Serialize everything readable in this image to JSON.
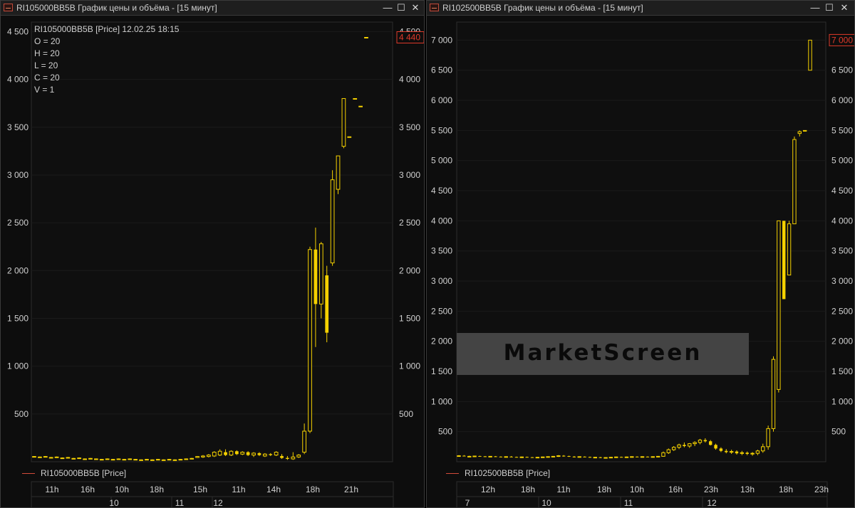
{
  "windows": [
    {
      "title": "RI105000BB5B График цены и объёма - [15 минут]",
      "info": {
        "header": "RI105000BB5B [Price] 12.02.25 18:15",
        "o": "O = 20",
        "h": "H = 20",
        "l": "L = 20",
        "c": "C = 20",
        "v": "V = 1"
      },
      "legend": "RI105000BB5B [Price]",
      "controls": {
        "minimize": "—",
        "maximize": "☐",
        "close": "✕"
      }
    },
    {
      "title": "RI102500BB5B График цены и объёма - [15 минут]",
      "legend": "RI102500BB5B [Price]",
      "controls": {
        "minimize": "—",
        "maximize": "☐",
        "close": "✕"
      }
    }
  ],
  "watermark": "MarketScreen",
  "colors": {
    "candle": "#f5d100",
    "last_price": "#e03a2a",
    "grid": "#1e1e1e",
    "axis_text": "#d0d0d0"
  },
  "chart_data": [
    {
      "type": "candlestick",
      "series_name": "RI105000BB5B [Price]",
      "ylim": [
        0,
        4600
      ],
      "y_ticks": [
        500,
        1000,
        1500,
        2000,
        2500,
        3000,
        3500,
        4000,
        4500
      ],
      "last_price": 4440,
      "last_price_label": "4 440",
      "x_time_labels": [
        "11h",
        "16h",
        "10h",
        "18h",
        "15h",
        "11h",
        "14h",
        "18h",
        "21h"
      ],
      "x_date_labels": [
        "10",
        "11",
        "12"
      ],
      "candles": [
        {
          "o": 55,
          "h": 60,
          "l": 50,
          "c": 55
        },
        {
          "o": 50,
          "h": 55,
          "l": 45,
          "c": 50
        },
        {
          "o": 55,
          "h": 60,
          "l": 50,
          "c": 55
        },
        {
          "o": 45,
          "h": 50,
          "l": 40,
          "c": 45
        },
        {
          "o": 50,
          "h": 55,
          "l": 45,
          "c": 50
        },
        {
          "o": 40,
          "h": 45,
          "l": 35,
          "c": 40
        },
        {
          "o": 45,
          "h": 50,
          "l": 40,
          "c": 45
        },
        {
          "o": 35,
          "h": 40,
          "l": 30,
          "c": 35
        },
        {
          "o": 40,
          "h": 45,
          "l": 35,
          "c": 40
        },
        {
          "o": 30,
          "h": 35,
          "l": 25,
          "c": 30
        },
        {
          "o": 35,
          "h": 40,
          "l": 30,
          "c": 35
        },
        {
          "o": 30,
          "h": 35,
          "l": 25,
          "c": 30
        },
        {
          "o": 25,
          "h": 30,
          "l": 20,
          "c": 25
        },
        {
          "o": 30,
          "h": 35,
          "l": 25,
          "c": 30
        },
        {
          "o": 25,
          "h": 30,
          "l": 20,
          "c": 25
        },
        {
          "o": 30,
          "h": 35,
          "l": 25,
          "c": 30
        },
        {
          "o": 25,
          "h": 30,
          "l": 20,
          "c": 25
        },
        {
          "o": 30,
          "h": 35,
          "l": 25,
          "c": 30
        },
        {
          "o": 25,
          "h": 30,
          "l": 20,
          "c": 25
        },
        {
          "o": 20,
          "h": 25,
          "l": 15,
          "c": 20
        },
        {
          "o": 25,
          "h": 30,
          "l": 20,
          "c": 25
        },
        {
          "o": 20,
          "h": 25,
          "l": 15,
          "c": 20
        },
        {
          "o": 25,
          "h": 30,
          "l": 20,
          "c": 25
        },
        {
          "o": 20,
          "h": 25,
          "l": 15,
          "c": 20
        },
        {
          "o": 25,
          "h": 30,
          "l": 20,
          "c": 25
        },
        {
          "o": 20,
          "h": 25,
          "l": 15,
          "c": 20
        },
        {
          "o": 25,
          "h": 30,
          "l": 20,
          "c": 25
        },
        {
          "o": 30,
          "h": 35,
          "l": 25,
          "c": 30
        },
        {
          "o": 35,
          "h": 40,
          "l": 30,
          "c": 35
        },
        {
          "o": 45,
          "h": 60,
          "l": 40,
          "c": 55
        },
        {
          "o": 50,
          "h": 70,
          "l": 40,
          "c": 60
        },
        {
          "o": 55,
          "h": 80,
          "l": 45,
          "c": 70
        },
        {
          "o": 60,
          "h": 110,
          "l": 50,
          "c": 100
        },
        {
          "o": 70,
          "h": 130,
          "l": 60,
          "c": 110
        },
        {
          "o": 100,
          "h": 130,
          "l": 60,
          "c": 70
        },
        {
          "o": 70,
          "h": 120,
          "l": 60,
          "c": 110
        },
        {
          "o": 110,
          "h": 120,
          "l": 70,
          "c": 80
        },
        {
          "o": 80,
          "h": 110,
          "l": 70,
          "c": 100
        },
        {
          "o": 100,
          "h": 110,
          "l": 60,
          "c": 70
        },
        {
          "o": 70,
          "h": 100,
          "l": 50,
          "c": 90
        },
        {
          "o": 90,
          "h": 100,
          "l": 60,
          "c": 70
        },
        {
          "o": 60,
          "h": 90,
          "l": 50,
          "c": 80
        },
        {
          "o": 80,
          "h": 90,
          "l": 60,
          "c": 70
        },
        {
          "o": 70,
          "h": 110,
          "l": 60,
          "c": 100
        },
        {
          "o": 60,
          "h": 80,
          "l": 30,
          "c": 40
        },
        {
          "o": 40,
          "h": 60,
          "l": 20,
          "c": 30
        },
        {
          "o": 30,
          "h": 100,
          "l": 20,
          "c": 50
        },
        {
          "o": 50,
          "h": 80,
          "l": 40,
          "c": 70
        },
        {
          "o": 100,
          "h": 400,
          "l": 80,
          "c": 320
        },
        {
          "o": 320,
          "h": 2250,
          "l": 300,
          "c": 2220
        },
        {
          "o": 2220,
          "h": 2450,
          "l": 1200,
          "c": 1650
        },
        {
          "o": 1650,
          "h": 2300,
          "l": 1500,
          "c": 2280
        },
        {
          "o": 1950,
          "h": 2050,
          "l": 1250,
          "c": 1350
        },
        {
          "o": 2080,
          "h": 3050,
          "l": 2050,
          "c": 2950
        },
        {
          "o": 2850,
          "h": 3200,
          "l": 2800,
          "c": 3200
        },
        {
          "o": 3300,
          "h": 3800,
          "l": 3280,
          "c": 3800
        },
        {
          "o": 3400,
          "h": 3400,
          "l": 3400,
          "c": 3400
        },
        {
          "o": 3800,
          "h": 3800,
          "l": 3800,
          "c": 3800
        },
        {
          "o": 3720,
          "h": 3720,
          "l": 3720,
          "c": 3720
        },
        {
          "o": 4440,
          "h": 4440,
          "l": 4440,
          "c": 4440
        }
      ]
    },
    {
      "type": "candlestick",
      "series_name": "RI102500BB5B [Price]",
      "ylim": [
        0,
        7300
      ],
      "y_ticks": [
        500,
        1000,
        1500,
        2000,
        2500,
        3000,
        3500,
        4000,
        4500,
        5000,
        5500,
        6000,
        6500,
        7000
      ],
      "last_price": 7000,
      "last_price_label": "7 000",
      "x_time_labels": [
        "12h",
        "18h",
        "11h",
        "18h",
        "10h",
        "16h",
        "23h",
        "13h",
        "18h",
        "23h"
      ],
      "x_date_labels": [
        "7",
        "10",
        "11",
        "12"
      ],
      "candles": [
        {
          "o": 100,
          "h": 110,
          "l": 90,
          "c": 100
        },
        {
          "o": 100,
          "h": 110,
          "l": 90,
          "c": 90
        },
        {
          "o": 90,
          "h": 100,
          "l": 80,
          "c": 90
        },
        {
          "o": 90,
          "h": 100,
          "l": 80,
          "c": 95
        },
        {
          "o": 95,
          "h": 100,
          "l": 85,
          "c": 90
        },
        {
          "o": 90,
          "h": 95,
          "l": 80,
          "c": 85
        },
        {
          "o": 85,
          "h": 95,
          "l": 75,
          "c": 90
        },
        {
          "o": 90,
          "h": 95,
          "l": 80,
          "c": 85
        },
        {
          "o": 85,
          "h": 90,
          "l": 75,
          "c": 80
        },
        {
          "o": 80,
          "h": 90,
          "l": 70,
          "c": 85
        },
        {
          "o": 85,
          "h": 95,
          "l": 75,
          "c": 80
        },
        {
          "o": 80,
          "h": 85,
          "l": 70,
          "c": 75
        },
        {
          "o": 75,
          "h": 85,
          "l": 65,
          "c": 80
        },
        {
          "o": 80,
          "h": 85,
          "l": 70,
          "c": 75
        },
        {
          "o": 75,
          "h": 80,
          "l": 65,
          "c": 70
        },
        {
          "o": 70,
          "h": 80,
          "l": 60,
          "c": 75
        },
        {
          "o": 75,
          "h": 85,
          "l": 65,
          "c": 80
        },
        {
          "o": 80,
          "h": 90,
          "l": 70,
          "c": 85
        },
        {
          "o": 85,
          "h": 95,
          "l": 75,
          "c": 90
        },
        {
          "o": 90,
          "h": 110,
          "l": 80,
          "c": 100
        },
        {
          "o": 100,
          "h": 110,
          "l": 85,
          "c": 95
        },
        {
          "o": 95,
          "h": 100,
          "l": 80,
          "c": 85
        },
        {
          "o": 85,
          "h": 95,
          "l": 70,
          "c": 80
        },
        {
          "o": 80,
          "h": 90,
          "l": 70,
          "c": 85
        },
        {
          "o": 85,
          "h": 90,
          "l": 75,
          "c": 80
        },
        {
          "o": 80,
          "h": 85,
          "l": 65,
          "c": 70
        },
        {
          "o": 70,
          "h": 80,
          "l": 60,
          "c": 75
        },
        {
          "o": 75,
          "h": 80,
          "l": 60,
          "c": 65
        },
        {
          "o": 65,
          "h": 75,
          "l": 55,
          "c": 70
        },
        {
          "o": 70,
          "h": 80,
          "l": 60,
          "c": 75
        },
        {
          "o": 75,
          "h": 85,
          "l": 65,
          "c": 80
        },
        {
          "o": 80,
          "h": 85,
          "l": 70,
          "c": 75
        },
        {
          "o": 75,
          "h": 85,
          "l": 65,
          "c": 80
        },
        {
          "o": 80,
          "h": 90,
          "l": 70,
          "c": 85
        },
        {
          "o": 85,
          "h": 90,
          "l": 75,
          "c": 80
        },
        {
          "o": 80,
          "h": 90,
          "l": 70,
          "c": 85
        },
        {
          "o": 85,
          "h": 90,
          "l": 75,
          "c": 80
        },
        {
          "o": 80,
          "h": 90,
          "l": 70,
          "c": 85
        },
        {
          "o": 85,
          "h": 95,
          "l": 75,
          "c": 90
        },
        {
          "o": 90,
          "h": 170,
          "l": 85,
          "c": 150
        },
        {
          "o": 150,
          "h": 220,
          "l": 130,
          "c": 200
        },
        {
          "o": 200,
          "h": 260,
          "l": 180,
          "c": 240
        },
        {
          "o": 240,
          "h": 300,
          "l": 210,
          "c": 280
        },
        {
          "o": 280,
          "h": 320,
          "l": 240,
          "c": 260
        },
        {
          "o": 260,
          "h": 310,
          "l": 230,
          "c": 300
        },
        {
          "o": 300,
          "h": 340,
          "l": 260,
          "c": 320
        },
        {
          "o": 320,
          "h": 380,
          "l": 290,
          "c": 360
        },
        {
          "o": 360,
          "h": 390,
          "l": 320,
          "c": 340
        },
        {
          "o": 340,
          "h": 360,
          "l": 270,
          "c": 280
        },
        {
          "o": 280,
          "h": 300,
          "l": 200,
          "c": 220
        },
        {
          "o": 220,
          "h": 240,
          "l": 160,
          "c": 180
        },
        {
          "o": 180,
          "h": 210,
          "l": 140,
          "c": 160
        },
        {
          "o": 160,
          "h": 200,
          "l": 130,
          "c": 170
        },
        {
          "o": 170,
          "h": 190,
          "l": 120,
          "c": 140
        },
        {
          "o": 140,
          "h": 180,
          "l": 110,
          "c": 150
        },
        {
          "o": 150,
          "h": 170,
          "l": 110,
          "c": 130
        },
        {
          "o": 130,
          "h": 160,
          "l": 100,
          "c": 140
        },
        {
          "o": 140,
          "h": 200,
          "l": 110,
          "c": 180
        },
        {
          "o": 180,
          "h": 300,
          "l": 150,
          "c": 250
        },
        {
          "o": 250,
          "h": 600,
          "l": 200,
          "c": 550
        },
        {
          "o": 550,
          "h": 1750,
          "l": 500,
          "c": 1700
        },
        {
          "o": 1200,
          "h": 4000,
          "l": 1150,
          "c": 4000
        },
        {
          "o": 4000,
          "h": 4000,
          "l": 2700,
          "c": 2700
        },
        {
          "o": 3100,
          "h": 4000,
          "l": 3100,
          "c": 3950
        },
        {
          "o": 3950,
          "h": 5400,
          "l": 3950,
          "c": 5350
        },
        {
          "o": 5450,
          "h": 5500,
          "l": 5400,
          "c": 5480
        },
        {
          "o": 5500,
          "h": 5500,
          "l": 5500,
          "c": 5500
        },
        {
          "o": 6500,
          "h": 7000,
          "l": 6500,
          "c": 7000
        }
      ]
    }
  ]
}
